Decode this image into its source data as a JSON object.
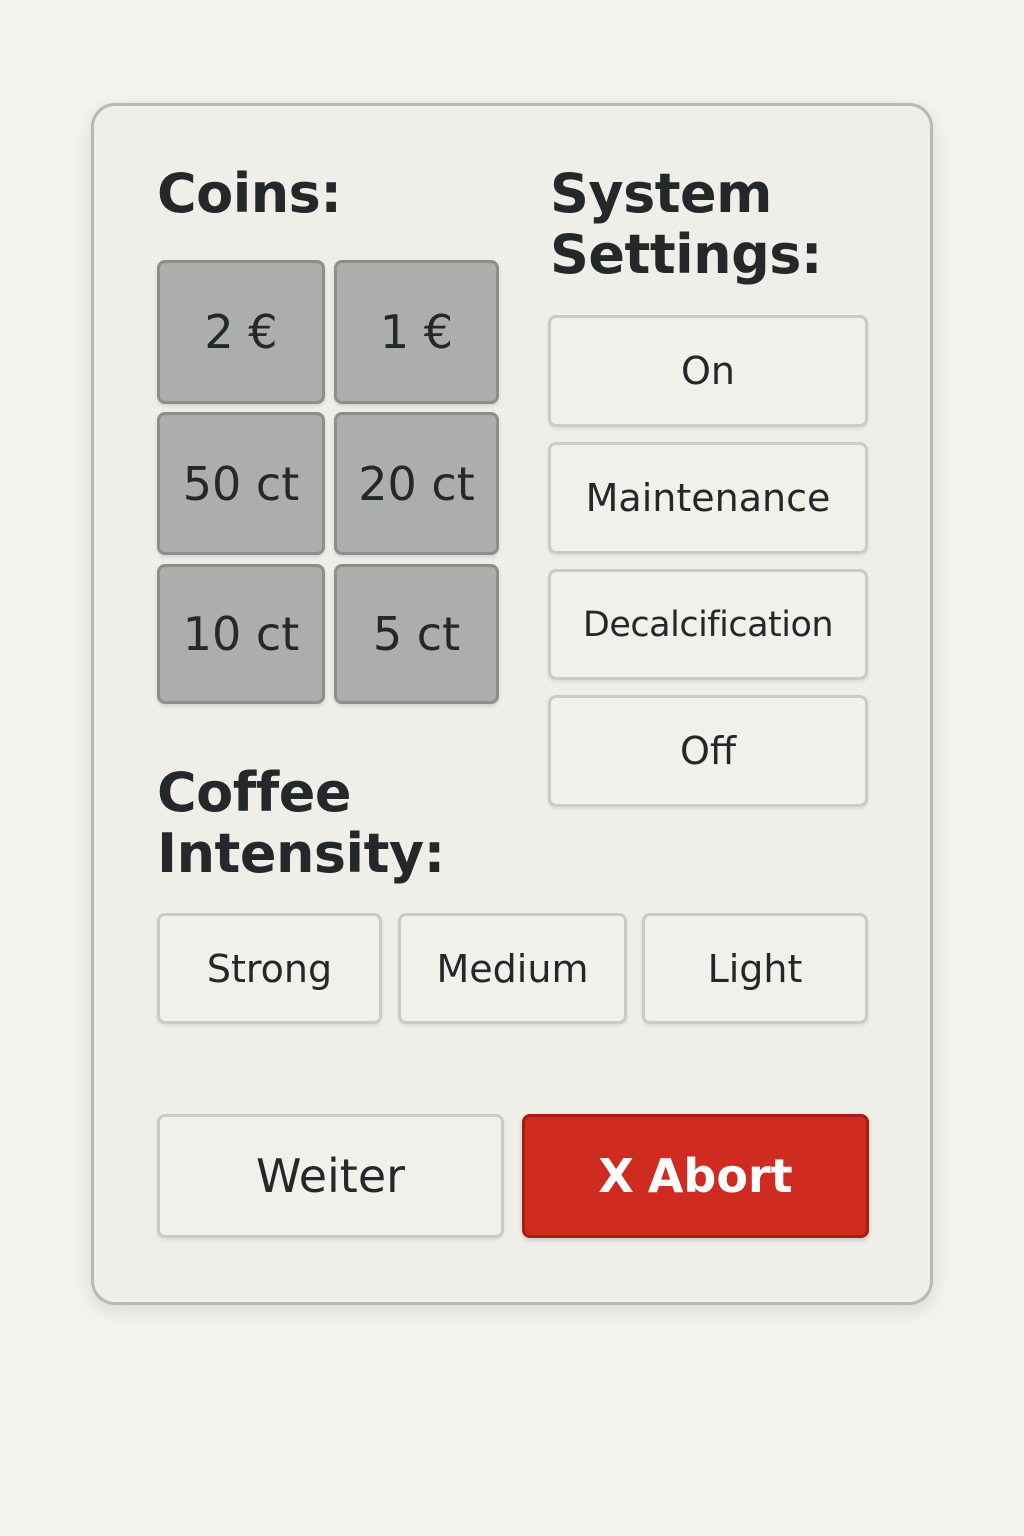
{
  "coins": {
    "heading": "Coins:",
    "items": [
      "2 €",
      "1 €",
      "50 ct",
      "20 ct",
      "10 ct",
      "5 ct"
    ]
  },
  "system_settings": {
    "heading_line1": "System",
    "heading_line2": "Settings:",
    "items": [
      "On",
      "Maintenance",
      "Decalcification",
      "Off"
    ]
  },
  "coffee_intensity": {
    "heading_line1": "Coffee",
    "heading_line2": "Intensity:",
    "items": [
      "Strong",
      "Medium",
      "Light"
    ]
  },
  "actions": {
    "weiter_label": "Weiter",
    "abort_mark": "X",
    "abort_label": "Abort"
  },
  "colors": {
    "page_background": "#f4f2ec",
    "panel_background": "#f0eee8",
    "coin_button": "#abaeaa",
    "abort_button": "#d02b20"
  }
}
